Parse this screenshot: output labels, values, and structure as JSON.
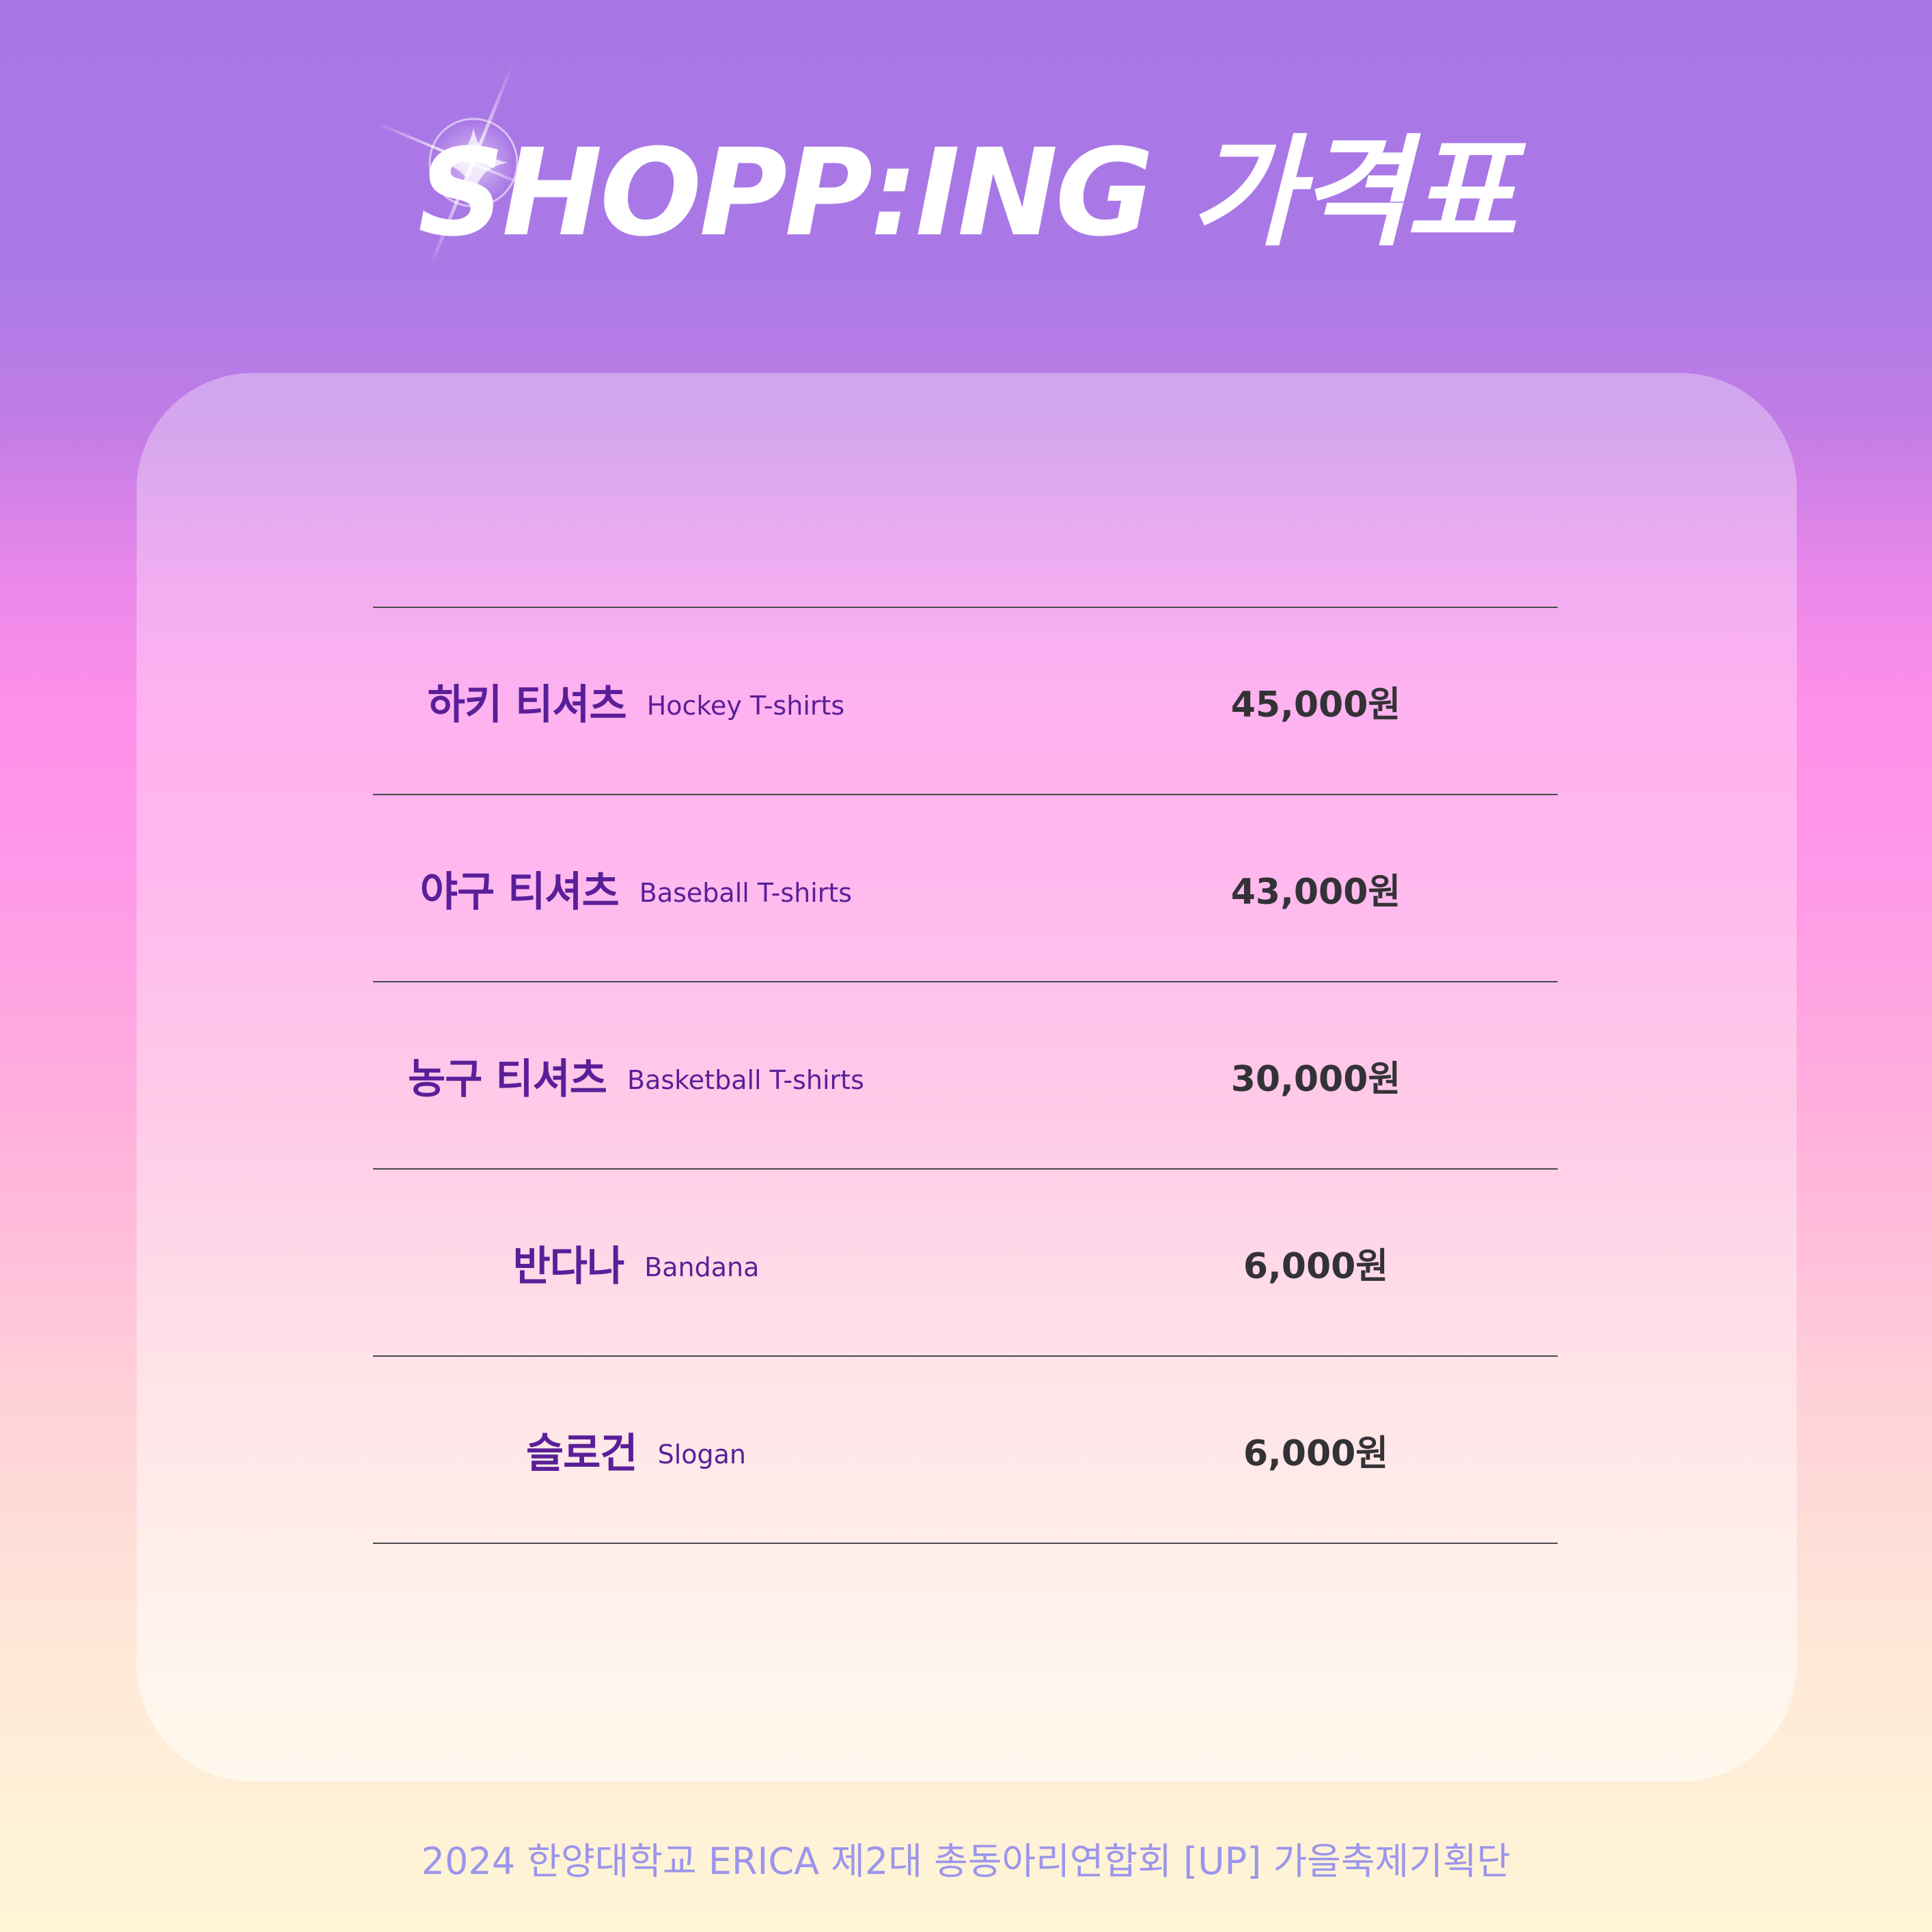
{
  "header": {
    "title": "SHOPP:ING 가격표"
  },
  "price_list": {
    "items": [
      {
        "name_ko": "하키 티셔츠",
        "name_en": "Hockey T-shirts",
        "price": "45,000원"
      },
      {
        "name_ko": "야구 티셔츠",
        "name_en": "Baseball T-shirts",
        "price": "43,000원"
      },
      {
        "name_ko": "농구 티셔츠",
        "name_en": "Basketball T-shirts",
        "price": "30,000원"
      },
      {
        "name_ko": "반다나",
        "name_en": "Bandana",
        "price": "6,000원"
      },
      {
        "name_ko": "슬로건",
        "name_en": "Slogan",
        "price": "6,000원"
      }
    ]
  },
  "footer": {
    "text": "2024 한양대학교 ERICA 제2대 총동아리연합회 [UP] 가을축제기획단"
  },
  "decorations": {
    "sparkle_icon": "sparkle-icon"
  },
  "colors": {
    "item_name": "#5a1f98",
    "price": "#333236",
    "footer": "#9b95ec",
    "title": "#ffffff"
  }
}
